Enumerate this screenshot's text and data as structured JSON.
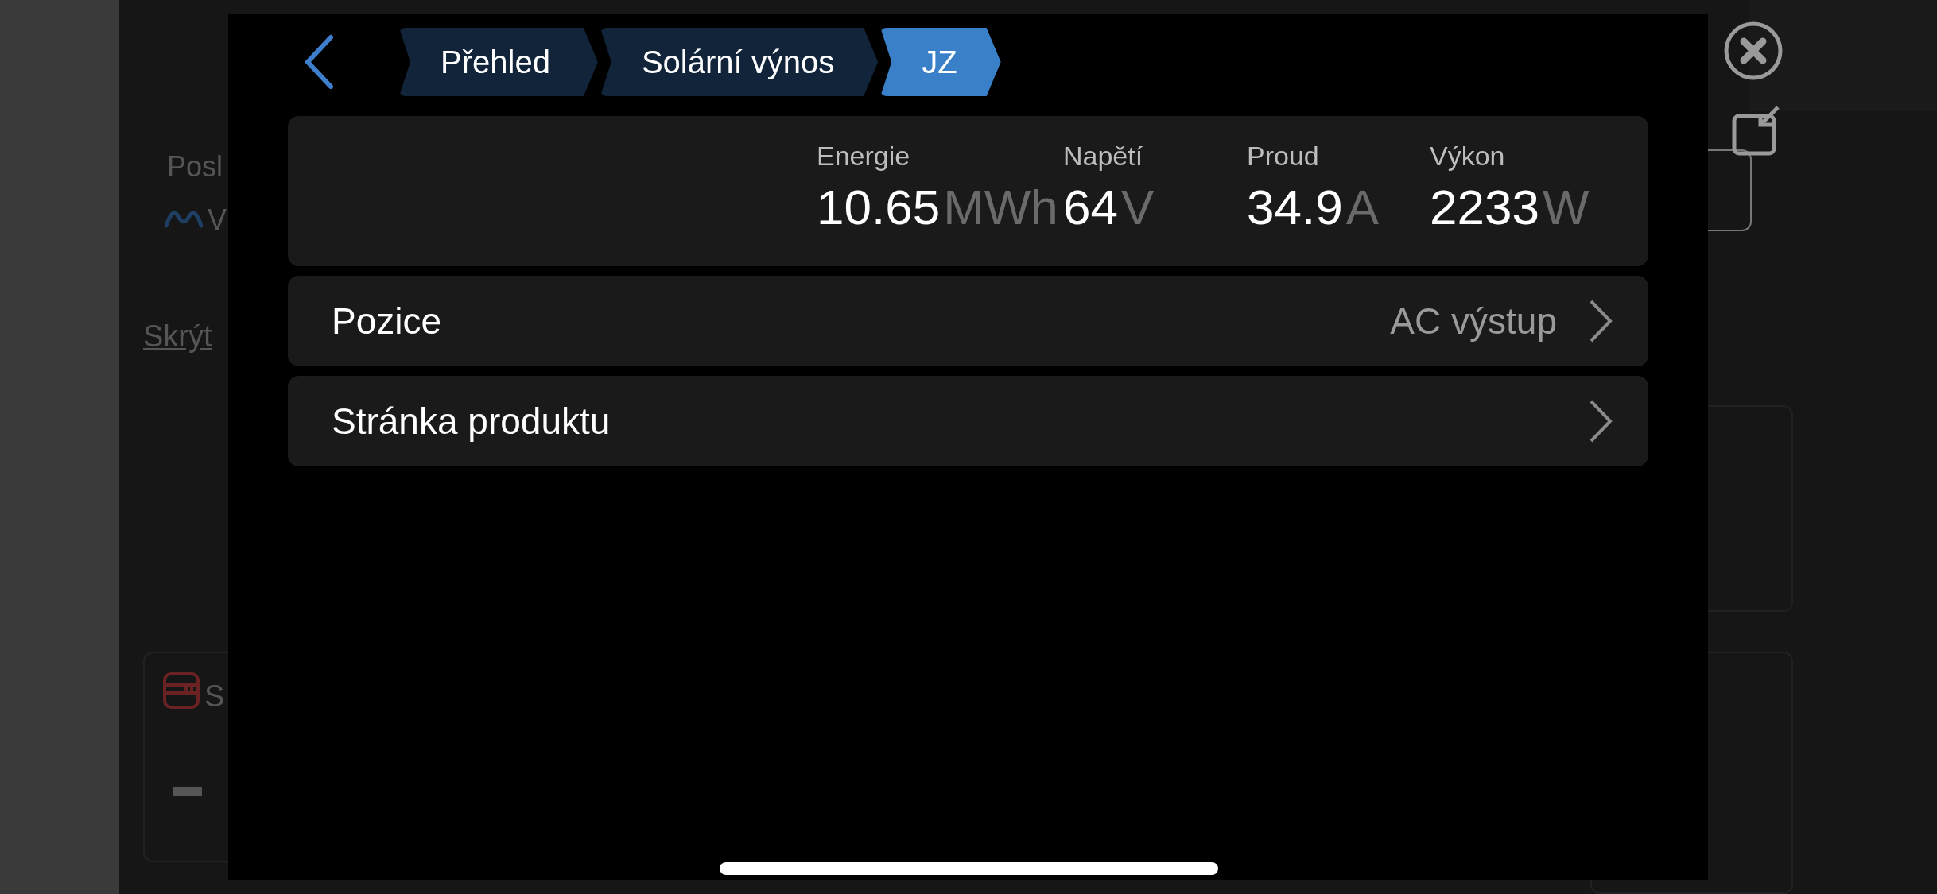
{
  "background": {
    "label": "Posl",
    "value": "V",
    "hide_link": "Skrýt",
    "card_title": "S"
  },
  "modal": {
    "breadcrumbs": [
      {
        "label": "Přehled",
        "selected": false
      },
      {
        "label": "Solární výnos",
        "selected": false
      },
      {
        "label": "JZ",
        "selected": true
      }
    ],
    "metrics": [
      {
        "label": "Energie",
        "value": "10.65",
        "unit": "MWh"
      },
      {
        "label": "Napětí",
        "value": "64",
        "unit": "V"
      },
      {
        "label": "Proud",
        "value": "34.9",
        "unit": "A"
      },
      {
        "label": "Výkon",
        "value": "2233",
        "unit": "W"
      }
    ],
    "rows": [
      {
        "label": "Pozice",
        "value": "AC výstup"
      },
      {
        "label": "Stránka produktu"
      }
    ]
  }
}
